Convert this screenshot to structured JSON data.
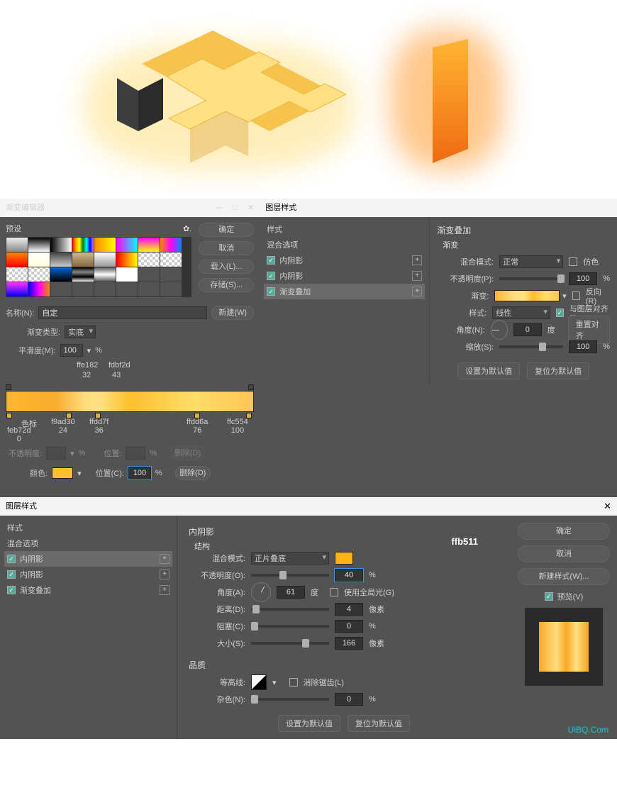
{
  "hero": {
    "code_overlay": "ffb511"
  },
  "gradientEditor": {
    "window_title": "渐变编辑器",
    "presets_label": "预设",
    "buttons": {
      "ok": "确定",
      "cancel": "取消",
      "load": "载入(L)...",
      "save": "存储(S)..."
    },
    "name_label": "名称(N):",
    "name_value": "自定",
    "new_btn": "新建(W)",
    "type_label": "渐变类型:",
    "type_value": "实底",
    "smooth_label": "平滑度(M):",
    "smooth_value": "100",
    "pct": "%",
    "stops_section": "色标",
    "opacity_label": "不透明度:",
    "opacity_pct": "%",
    "location_label": "位置:",
    "delete_btn": "删除(D)",
    "color_label": "颜色:",
    "locC_label": "位置(C):",
    "locC_value": "100",
    "annotTop": [
      {
        "p": 32,
        "hex": "ffe182",
        "pos": "32"
      },
      {
        "p": 43,
        "hex": "fdbf2d",
        "pos": "43"
      }
    ],
    "annotBot": [
      {
        "p": 0,
        "hex": "feb72d",
        "pos": "0"
      },
      {
        "p": 24,
        "hex": "f9ad30",
        "pos": "24"
      },
      {
        "p": 36,
        "hex": "ffdd7f",
        "pos": "36"
      },
      {
        "p": 76,
        "hex": "ffdd6a",
        "pos": "76"
      },
      {
        "p": 100,
        "hex": "ffc554",
        "pos": "100"
      }
    ]
  },
  "layerStyleTop": {
    "title": "图层样式",
    "styles_label": "样式",
    "blend_opts": "混合选项",
    "items": [
      {
        "label": "内阴影",
        "sel": false
      },
      {
        "label": "内阴影",
        "sel": false
      },
      {
        "label": "渐变叠加",
        "sel": true
      }
    ],
    "section_title": "渐变叠加",
    "sub_title": "渐变",
    "blend_mode_label": "混合模式:",
    "blend_mode_value": "正常",
    "dither_label": "仿色",
    "opacity_label": "不透明度(P):",
    "opacity_value": "100",
    "opacity_pct": "%",
    "gradient_label": "渐变:",
    "reverse_label": "反向(R)",
    "style_label": "样式:",
    "style_value": "线性",
    "align_label": "与图层对齐(I)",
    "angle_label": "角度(N):",
    "angle_value": "0",
    "angle_unit": "度",
    "reset_align": "重置对齐",
    "scale_label": "缩放(S):",
    "scale_value": "100",
    "scale_pct": "%",
    "make_default": "设置为默认值",
    "reset_default": "复位为默认值"
  },
  "layerStyleBottom": {
    "title": "图层样式",
    "styles_label": "样式",
    "blend_opts": "混合选项",
    "items": [
      {
        "label": "内阴影",
        "sel": true
      },
      {
        "label": "内阴影",
        "sel": false
      },
      {
        "label": "渐变叠加",
        "sel": false
      }
    ],
    "section_title": "内阴影",
    "struct_title": "结构",
    "color_code": "ffb511",
    "blend_mode_label": "混合模式:",
    "blend_mode_value": "正片叠底",
    "opacity_label": "不透明度(O):",
    "opacity_value": "40",
    "op_pct": "%",
    "angle_label": "角度(A):",
    "angle_value": "61",
    "angle_unit": "度",
    "global_label": "使用全局光(G)",
    "distance_label": "距离(D):",
    "distance_value": "4",
    "distance_unit": "像素",
    "spread_label": "阻塞(C):",
    "spread_value": "0",
    "spread_unit": "%",
    "size_label": "大小(S):",
    "size_value": "166",
    "size_unit": "像素",
    "quality_title": "品质",
    "contour_label": "等高线:",
    "aa_label": "消除锯齿(L)",
    "noise_label": "杂色(N):",
    "noise_value": "0",
    "noise_unit": "%",
    "make_default": "设置为默认值",
    "reset_default": "复位为默认值",
    "ok": "确定",
    "cancel": "取消",
    "new_style": "新建样式(W)...",
    "preview_label": "预览(V)",
    "watermark": "UiBQ.Com"
  }
}
